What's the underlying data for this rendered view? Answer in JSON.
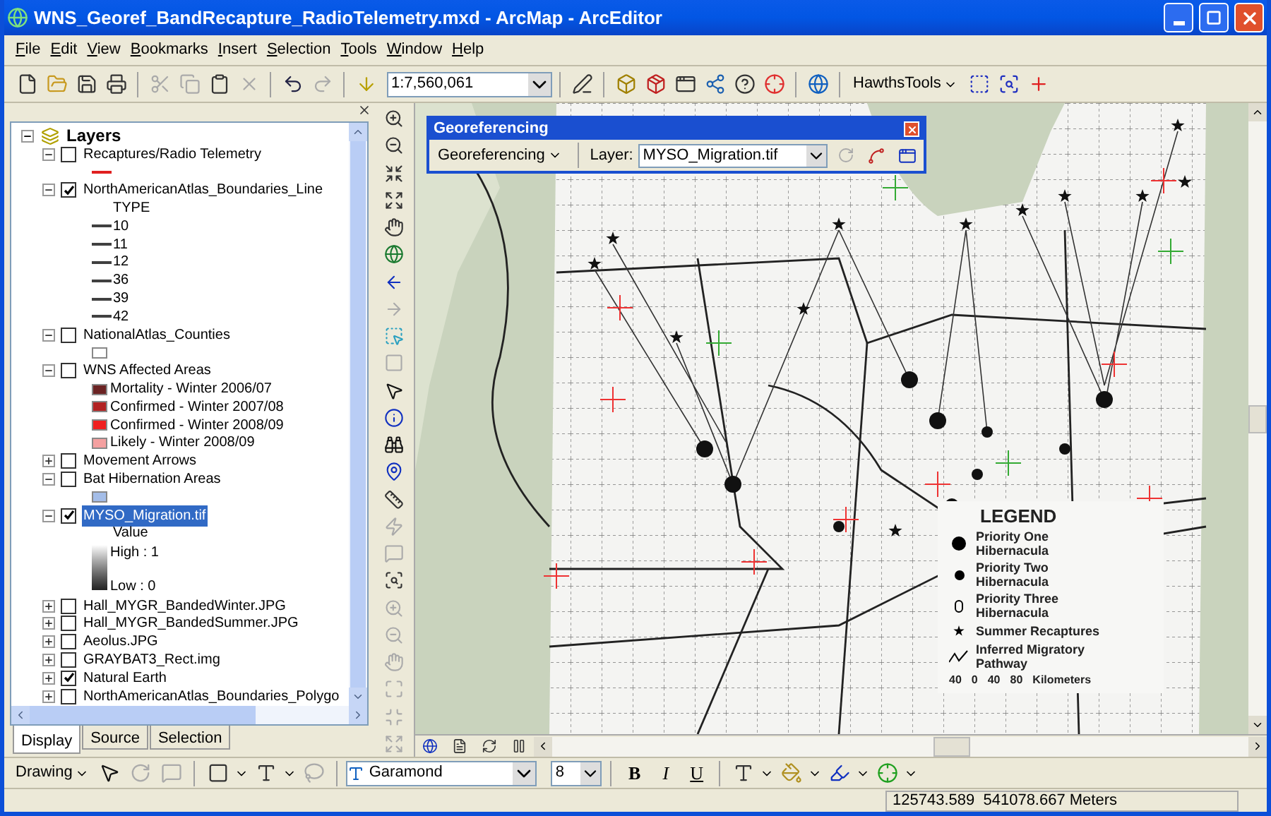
{
  "window": {
    "title": "WNS_Georef_BandRecapture_RadioTelemetry.mxd - ArcMap - ArcEditor"
  },
  "menu": [
    "File",
    "Edit",
    "View",
    "Bookmarks",
    "Insert",
    "Selection",
    "Tools",
    "Window",
    "Help"
  ],
  "toolbar": {
    "scale": "1:7,560,061",
    "hawths_tools": "HawthsTools"
  },
  "toc": {
    "root": "Layers",
    "layers": [
      {
        "name": "Recaptures/Radio Telemetry",
        "checked": false,
        "expanded": true,
        "selected": false,
        "legend": [
          {
            "kind": "line",
            "color": "#e02020"
          }
        ]
      },
      {
        "name": "NorthAmericanAtlas_Boundaries_Line",
        "checked": true,
        "expanded": true,
        "selected": false,
        "legend": [
          {
            "kind": "heading",
            "label": "TYPE"
          },
          {
            "kind": "line",
            "label": "10",
            "color": "#404040"
          },
          {
            "kind": "line",
            "label": "11",
            "color": "#404040"
          },
          {
            "kind": "line",
            "label": "12",
            "color": "#404040"
          },
          {
            "kind": "line",
            "label": "36",
            "color": "#404040"
          },
          {
            "kind": "line",
            "label": "39",
            "color": "#404040"
          },
          {
            "kind": "line",
            "label": "42",
            "color": "#404040"
          }
        ]
      },
      {
        "name": "NationalAtlas_Counties",
        "checked": false,
        "expanded": true,
        "selected": false,
        "legend": [
          {
            "kind": "swatch",
            "color": "#ffffff"
          }
        ]
      },
      {
        "name": "WNS Affected Areas",
        "checked": false,
        "expanded": true,
        "selected": false,
        "legend": [
          {
            "kind": "swatch",
            "label": "Mortality - Winter 2006/07",
            "color": "#6b2323"
          },
          {
            "kind": "swatch",
            "label": "Confirmed - Winter 2007/08",
            "color": "#b22222"
          },
          {
            "kind": "swatch",
            "label": "Confirmed - Winter 2008/09",
            "color": "#f02020"
          },
          {
            "kind": "swatch",
            "label": "Likely - Winter 2008/09",
            "color": "#f4a0a0"
          }
        ]
      },
      {
        "name": "Movement Arrows",
        "checked": false,
        "expanded": false,
        "selected": false
      },
      {
        "name": "Bat Hibernation Areas",
        "checked": false,
        "expanded": true,
        "selected": false,
        "legend": [
          {
            "kind": "swatch",
            "color": "#a4bde8"
          }
        ]
      },
      {
        "name": "MYSO_Migration.tif",
        "checked": true,
        "expanded": true,
        "selected": true,
        "legend": [
          {
            "kind": "heading",
            "label": "Value"
          },
          {
            "kind": "ramp",
            "high": "High : 1",
            "low": "Low : 0"
          }
        ]
      },
      {
        "name": "Hall_MYGR_BandedWinter.JPG",
        "checked": false,
        "expanded": false,
        "selected": false
      },
      {
        "name": "Hall_MYGR_BandedSummer.JPG",
        "checked": false,
        "expanded": false,
        "selected": false
      },
      {
        "name": "Aeolus.JPG",
        "checked": false,
        "expanded": false,
        "selected": false
      },
      {
        "name": "GRAYBAT3_Rect.img",
        "checked": false,
        "expanded": false,
        "selected": false
      },
      {
        "name": "Natural Earth",
        "checked": true,
        "expanded": false,
        "selected": false
      },
      {
        "name": "NorthAmericanAtlas_Boundaries_Polygo",
        "checked": false,
        "expanded": false,
        "selected": false
      }
    ]
  },
  "toc_tabs": [
    {
      "label": "Display",
      "selected": true
    },
    {
      "label": "Source",
      "selected": false
    },
    {
      "label": "Selection",
      "selected": false
    }
  ],
  "georeferencing": {
    "title": "Georeferencing",
    "menu": "Georeferencing",
    "layer_label": "Layer:",
    "layer_value": "MYSO_Migration.tif"
  },
  "map_legend": {
    "title": "LEGEND",
    "items": [
      {
        "kind": "large-dot",
        "label": "Priority One Hibernacula"
      },
      {
        "kind": "dot",
        "label": "Priority Two Hibernacula"
      },
      {
        "kind": "hollow",
        "label": "Priority Three Hibernacula"
      },
      {
        "kind": "star",
        "label": "Summer Recaptures"
      },
      {
        "kind": "arrow",
        "label": "Inferred Migratory Pathway"
      }
    ],
    "scale": [
      "40",
      "0",
      "40",
      "80",
      "Kilometers"
    ]
  },
  "drawing_toolbar": {
    "menu": "Drawing",
    "font": "Garamond",
    "size": "8",
    "bold": "B",
    "italic": "I",
    "underline": "U"
  },
  "status_bar": {
    "coordinates": "125743.589  541078.667 Meters"
  }
}
